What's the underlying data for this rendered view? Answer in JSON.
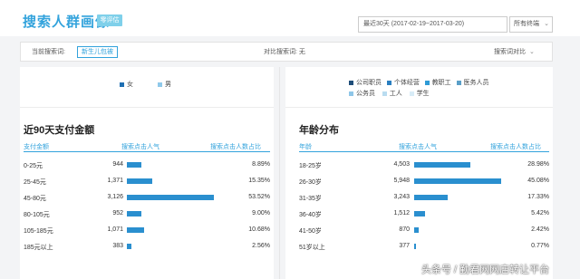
{
  "header": {
    "title": "搜索人群画像",
    "tag": "零评估",
    "date_range": "最近30天 (2017-02-19~2017-03-20)",
    "terminal_select": "所有终端"
  },
  "search_bar": {
    "current_label": "当前搜索词:",
    "current_keyword": "新生儿包被",
    "compare_label": "对比搜索词: 无",
    "compare_button": "搜索词对比"
  },
  "gender_legend": [
    {
      "label": "女",
      "color": "#1f6fb2"
    },
    {
      "label": "男",
      "color": "#8fc9ea"
    }
  ],
  "occupation_legend": [
    {
      "label": "公司职员",
      "color": "#1f4e79"
    },
    {
      "label": "个体经营",
      "color": "#2a7fc0"
    },
    {
      "label": "教职工",
      "color": "#2f9bd6"
    },
    {
      "label": "医务人员",
      "color": "#5a9fc8"
    },
    {
      "label": "公务员",
      "color": "#8ec6e8"
    },
    {
      "label": "工人",
      "color": "#b9dcf0"
    },
    {
      "label": "学生",
      "color": "#d8ecf7"
    }
  ],
  "spend": {
    "title": "近90天支付金额",
    "col_label": "支付金额",
    "col_popularity": "搜索点击人气",
    "col_share": "搜索点击人数占比",
    "rows": [
      {
        "label": "0-25元",
        "value": "944",
        "share": "8.89%",
        "pct": 8.89
      },
      {
        "label": "25-45元",
        "value": "1,371",
        "share": "15.35%",
        "pct": 15.35
      },
      {
        "label": "45-80元",
        "value": "3,126",
        "share": "53.52%",
        "pct": 53.52
      },
      {
        "label": "80-105元",
        "value": "952",
        "share": "9.00%",
        "pct": 9.0
      },
      {
        "label": "105-185元",
        "value": "1,071",
        "share": "10.68%",
        "pct": 10.68
      },
      {
        "label": "185元以上",
        "value": "383",
        "share": "2.56%",
        "pct": 2.56
      }
    ]
  },
  "age": {
    "title": "年龄分布",
    "col_label": "年龄",
    "col_popularity": "搜索点击人气",
    "col_share": "搜索点击人数占比",
    "rows": [
      {
        "label": "18-25岁",
        "value": "4,503",
        "share": "28.98%",
        "pct": 28.98
      },
      {
        "label": "26-30岁",
        "value": "5,948",
        "share": "45.08%",
        "pct": 45.08
      },
      {
        "label": "31-35岁",
        "value": "3,243",
        "share": "17.33%",
        "pct": 17.33
      },
      {
        "label": "36-40岁",
        "value": "1,512",
        "share": "5.42%",
        "pct": 5.42
      },
      {
        "label": "41-50岁",
        "value": "870",
        "share": "2.42%",
        "pct": 2.42
      },
      {
        "label": "51岁以上",
        "value": "377",
        "share": "0.77%",
        "pct": 0.77
      }
    ]
  },
  "watermark": "头条号 / 勤君网网店转让平台"
}
